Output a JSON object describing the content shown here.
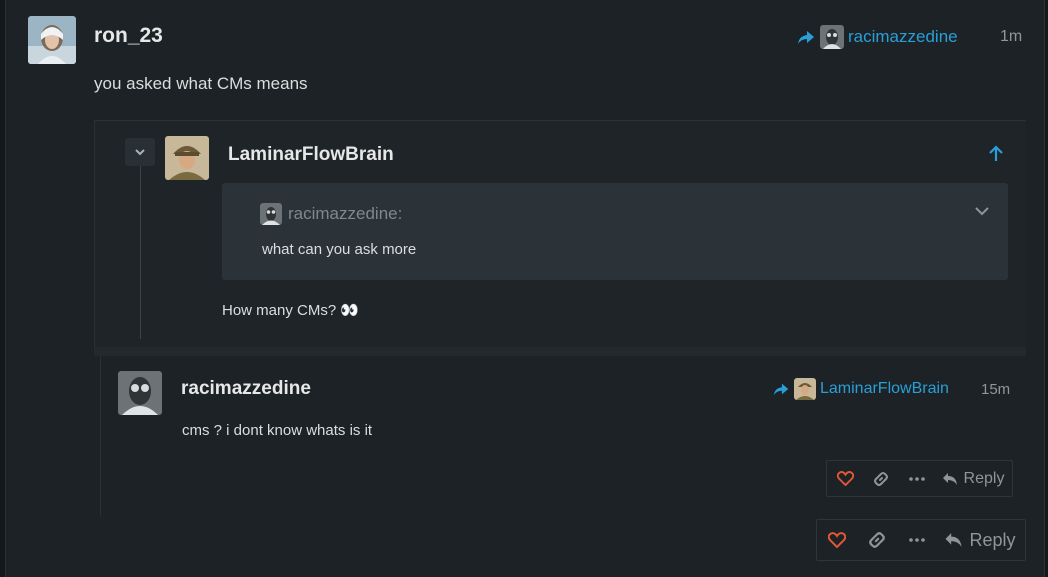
{
  "main_post": {
    "username": "ron_23",
    "reply_to_user": "racimazzedine",
    "time": "1m",
    "body": "you asked what CMs means"
  },
  "embedded_post": {
    "username": "LaminarFlowBrain",
    "quote": {
      "author": "racimazzedine:",
      "text": "what can you ask more"
    },
    "body": "How many CMs? 👀"
  },
  "reply_post": {
    "username": "racimazzedine",
    "reply_to_user": "LaminarFlowBrain",
    "time": "15m",
    "body": "cms ? i dont know whats is it",
    "reply_label": "Reply"
  },
  "main_actions": {
    "reply_label": "Reply"
  },
  "colors": {
    "accent": "#2a9fd6",
    "like": "#e45735",
    "background": "#1c2226"
  }
}
